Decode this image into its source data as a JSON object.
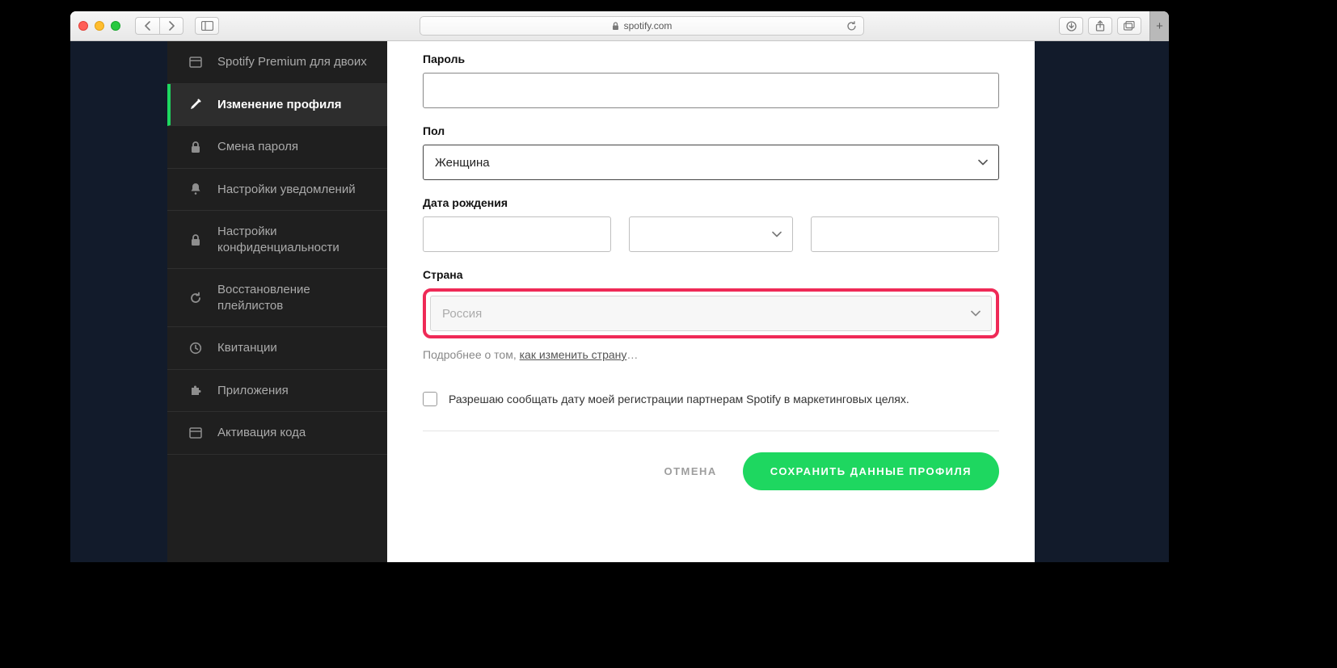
{
  "browser": {
    "url_host": "spotify.com"
  },
  "sidebar": {
    "items": [
      {
        "label": "Spotify Premium для двоих",
        "name": "sidebar-item-premium-duo",
        "icon": "card-icon"
      },
      {
        "label": "Изменение профиля",
        "name": "sidebar-item-edit-profile",
        "icon": "pencil-icon",
        "active": true
      },
      {
        "label": "Смена пароля",
        "name": "sidebar-item-change-password",
        "icon": "lock-icon"
      },
      {
        "label": "Настройки уведомлений",
        "name": "sidebar-item-notifications",
        "icon": "bell-icon"
      },
      {
        "label": "Настройки конфиденциальности",
        "name": "sidebar-item-privacy",
        "icon": "lock-icon"
      },
      {
        "label": "Восстановление плейлистов",
        "name": "sidebar-item-recover-playlists",
        "icon": "refresh-icon"
      },
      {
        "label": "Квитанции",
        "name": "sidebar-item-receipts",
        "icon": "clock-icon"
      },
      {
        "label": "Приложения",
        "name": "sidebar-item-apps",
        "icon": "puzzle-icon"
      },
      {
        "label": "Активация кода",
        "name": "sidebar-item-redeem",
        "icon": "card-icon"
      }
    ]
  },
  "form": {
    "password_label": "Пароль",
    "password_value": "",
    "gender_label": "Пол",
    "gender_value": "Женщина",
    "dob_label": "Дата рождения",
    "dob_day": "",
    "dob_month": "",
    "dob_year": "",
    "country_label": "Страна",
    "country_value": "Россия",
    "hint_prefix": "Подробнее о том, ",
    "hint_link": "как изменить страну",
    "hint_suffix": "…",
    "marketing_consent": "Разрешаю сообщать дату моей регистрации партнерам Spotify в маркетинговых целях.",
    "cancel": "ОТМЕНА",
    "save": "СОХРАНИТЬ ДАННЫЕ ПРОФИЛЯ"
  }
}
